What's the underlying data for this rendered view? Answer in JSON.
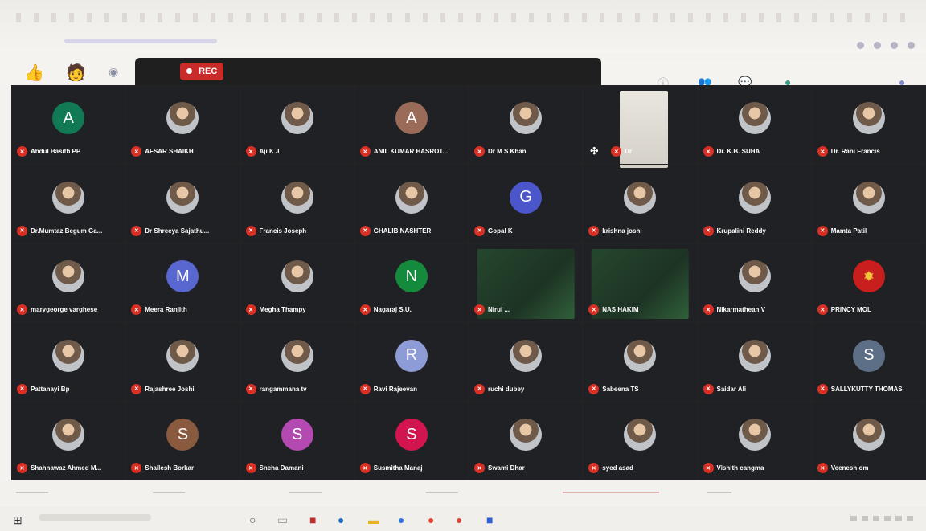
{
  "meeting": {
    "rec_label": "REC"
  },
  "colors": {
    "recording": "#c92a2a",
    "grid_bg": "#202124",
    "mic_off": "#d93025"
  },
  "participants": [
    {
      "name": "Abdul Basith PP",
      "avatar": {
        "type": "letter",
        "letter": "A",
        "color": "#117a55"
      }
    },
    {
      "name": "AFSAR SHAIKH",
      "avatar": {
        "type": "photo"
      }
    },
    {
      "name": "Aji K J",
      "avatar": {
        "type": "photo"
      }
    },
    {
      "name": "ANIL KUMAR HASROT...",
      "avatar": {
        "type": "letter",
        "letter": "A",
        "color": "#9b6b5a"
      }
    },
    {
      "name": "Dr M S Khan",
      "avatar": {
        "type": "photo"
      }
    },
    {
      "name": "Dr",
      "avatar": {
        "type": "video",
        "style": "pale"
      },
      "pinned": true
    },
    {
      "name": "Dr. K.B. SUHA",
      "avatar": {
        "type": "photo"
      }
    },
    {
      "name": "Dr. Rani Francis",
      "avatar": {
        "type": "photo"
      }
    },
    {
      "name": "Dr.Mumtaz Begum Ga...",
      "avatar": {
        "type": "photo"
      }
    },
    {
      "name": "Dr Shreeya Sajathu...",
      "avatar": {
        "type": "photo"
      }
    },
    {
      "name": "Francis Joseph",
      "avatar": {
        "type": "photo"
      }
    },
    {
      "name": "GHALIB NASHTER",
      "avatar": {
        "type": "photo"
      }
    },
    {
      "name": "Gopal K",
      "avatar": {
        "type": "letter",
        "letter": "G",
        "color": "#4a56c9"
      }
    },
    {
      "name": "krishna joshi",
      "avatar": {
        "type": "photo"
      }
    },
    {
      "name": "Krupalini Reddy",
      "avatar": {
        "type": "photo"
      }
    },
    {
      "name": "Mamta Patil",
      "avatar": {
        "type": "photo"
      }
    },
    {
      "name": "marygeorge varghese",
      "avatar": {
        "type": "photo"
      }
    },
    {
      "name": "Meera Ranjith",
      "avatar": {
        "type": "letter",
        "letter": "M",
        "color": "#5967d1"
      }
    },
    {
      "name": "Megha Thampy",
      "avatar": {
        "type": "photo"
      }
    },
    {
      "name": "Nagaraj S.U.",
      "avatar": {
        "type": "letter",
        "letter": "N",
        "color": "#148a3c"
      }
    },
    {
      "name": "Nirul ...",
      "avatar": {
        "type": "video"
      }
    },
    {
      "name": "NAS HAKIM",
      "avatar": {
        "type": "video"
      }
    },
    {
      "name": "Nikarmathean V",
      "avatar": {
        "type": "photo"
      }
    },
    {
      "name": "PRINCY MOL",
      "avatar": {
        "type": "logo",
        "color": "#c81e1e"
      }
    },
    {
      "name": "Pattanayi Bp",
      "avatar": {
        "type": "photo"
      }
    },
    {
      "name": "Rajashree Joshi",
      "avatar": {
        "type": "photo"
      }
    },
    {
      "name": "rangammana tv",
      "avatar": {
        "type": "photo"
      }
    },
    {
      "name": "Ravi Rajeevan",
      "avatar": {
        "type": "letter",
        "letter": "R",
        "color": "#8d9bd6"
      }
    },
    {
      "name": "ruchi dubey",
      "avatar": {
        "type": "photo"
      }
    },
    {
      "name": "Sabeena TS",
      "avatar": {
        "type": "photo"
      }
    },
    {
      "name": "Saidar Ali",
      "avatar": {
        "type": "photo"
      }
    },
    {
      "name": "SALLYKUTTY THOMAS",
      "avatar": {
        "type": "letter",
        "letter": "S",
        "color": "#5d6f86"
      }
    },
    {
      "name": "Shahnawaz Ahmed M...",
      "avatar": {
        "type": "photo"
      }
    },
    {
      "name": "Shailesh Borkar",
      "avatar": {
        "type": "letter",
        "letter": "S",
        "color": "#8a5a3e"
      }
    },
    {
      "name": "Sneha Damani",
      "avatar": {
        "type": "letter",
        "letter": "S",
        "color": "#b349b1"
      }
    },
    {
      "name": "Susmitha Manaj",
      "avatar": {
        "type": "letter",
        "letter": "S",
        "color": "#d2144f"
      }
    },
    {
      "name": "Swami Dhar",
      "avatar": {
        "type": "photo"
      }
    },
    {
      "name": "syed asad",
      "avatar": {
        "type": "photo"
      }
    },
    {
      "name": "Vishith cangma",
      "avatar": {
        "type": "photo"
      }
    },
    {
      "name": "Veenesh om",
      "avatar": {
        "type": "photo"
      }
    }
  ]
}
